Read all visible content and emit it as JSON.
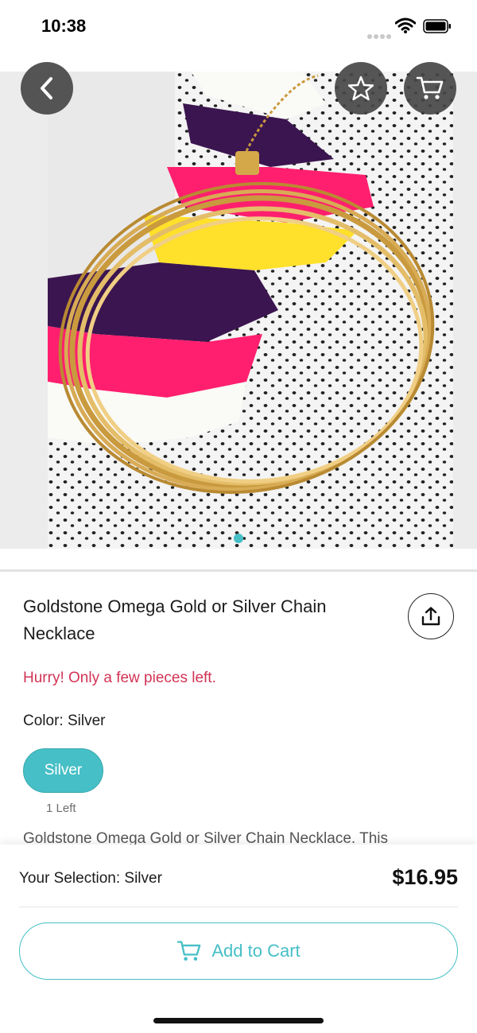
{
  "status_bar": {
    "time": "10:38"
  },
  "product": {
    "title": "Goldstone Omega Gold or Silver Chain Necklace",
    "urgency": "Hurry! Only a few pieces left.",
    "color_prefix": "Color: ",
    "selected_color": "Silver",
    "options": [
      {
        "label": "Silver",
        "stock": "1 Left"
      }
    ],
    "description": "Goldstone Omega Gold or Silver Chain Necklace. This",
    "image_count": 1
  },
  "icons": {
    "back": "chevron-left-icon",
    "favorite": "star-icon",
    "cart": "cart-icon",
    "share": "share-icon"
  },
  "bottom": {
    "selection_prefix": "Your Selection: ",
    "selection_value": "Silver",
    "price": "$16.95",
    "add_to_cart": "Add to Cart"
  },
  "colors": {
    "accent": "#46bfc6",
    "urgency": "#d23355",
    "overlay": "#464646"
  }
}
